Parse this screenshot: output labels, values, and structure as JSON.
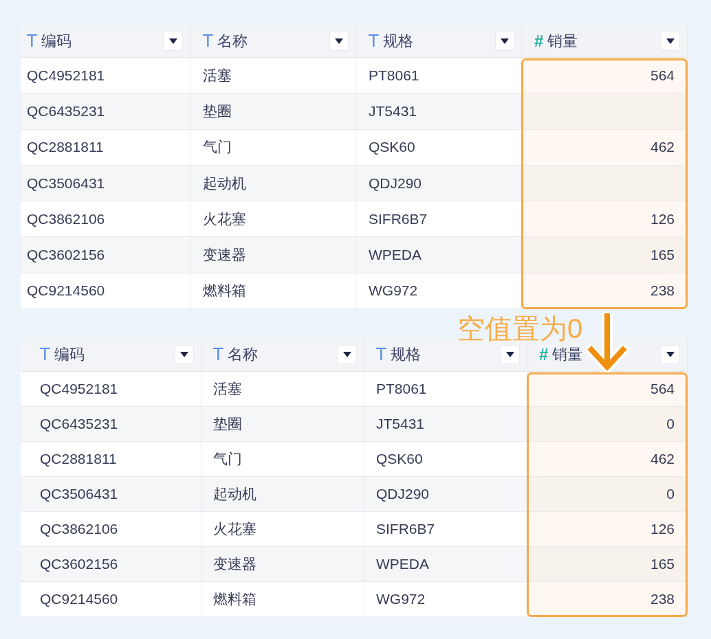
{
  "tables": [
    {
      "columns": [
        {
          "icon": "T",
          "label": "编码",
          "kind": "text",
          "highlighted": false
        },
        {
          "icon": "T",
          "label": "名称",
          "kind": "text",
          "highlighted": false
        },
        {
          "icon": "T",
          "label": "规格",
          "kind": "text",
          "highlighted": false
        },
        {
          "icon": "#",
          "label": "销量",
          "kind": "number",
          "highlighted": true
        }
      ],
      "rows": [
        [
          "QC4952181",
          "活塞",
          "PT8061",
          "564"
        ],
        [
          "QC6435231",
          "垫圈",
          "JT5431",
          null
        ],
        [
          "QC2881811",
          "气门",
          "QSK60",
          "462"
        ],
        [
          "QC3506431",
          "起动机",
          "QDJ290",
          null
        ],
        [
          "QC3862106",
          "火花塞",
          "SIFR6B7",
          "126"
        ],
        [
          "QC3602156",
          "变速器",
          "WPEDA",
          "165"
        ],
        [
          "QC9214560",
          "燃料箱",
          "WG972",
          "238"
        ]
      ]
    },
    {
      "columns": [
        {
          "icon": "T",
          "label": "编码",
          "kind": "text",
          "highlighted": false
        },
        {
          "icon": "T",
          "label": "名称",
          "kind": "text",
          "highlighted": false
        },
        {
          "icon": "T",
          "label": "规格",
          "kind": "text",
          "highlighted": false
        },
        {
          "icon": "#",
          "label": "销量",
          "kind": "number",
          "highlighted": true
        }
      ],
      "rows": [
        [
          "QC4952181",
          "活塞",
          "PT8061",
          "564"
        ],
        [
          "QC6435231",
          "垫圈",
          "JT5431",
          "0"
        ],
        [
          "QC2881811",
          "气门",
          "QSK60",
          "462"
        ],
        [
          "QC3506431",
          "起动机",
          "QDJ290",
          "0"
        ],
        [
          "QC3862106",
          "火花塞",
          "SIFR6B7",
          "126"
        ],
        [
          "QC3602156",
          "变速器",
          "WPEDA",
          "165"
        ],
        [
          "QC9214560",
          "燃料箱",
          "WG972",
          "238"
        ]
      ]
    }
  ],
  "annotation": {
    "text": "空值置为0"
  }
}
